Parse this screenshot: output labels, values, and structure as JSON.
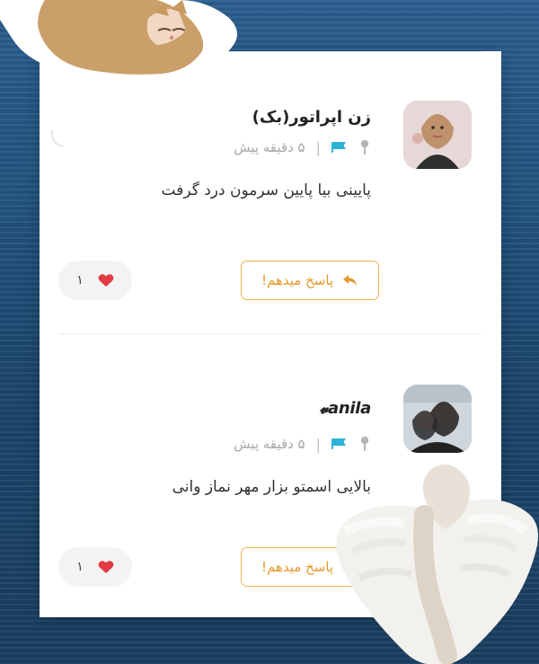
{
  "comments": [
    {
      "username": "زن اپراتور(بک)",
      "time": "۵ دقیقه پیش",
      "text": "پایینی بیا پایین سرمون درد گرفت",
      "reply_label": "پاسخ میدهم!",
      "likes": "۱"
    },
    {
      "username": "𝓿anila",
      "time": "۵ دقیقه پیش",
      "text": "بالایی اسمتو بزار مهر نماز وانی",
      "reply_label": "پاسخ میدهم!",
      "likes": "۱"
    }
  ],
  "colors": {
    "accent": "#f0b24b",
    "flag": "#2cb2d6",
    "heart": "#e33a44"
  },
  "icons": {
    "pin": "pin-icon",
    "flag": "flag-icon",
    "reply": "reply-arrow-icon",
    "heart": "heart-icon"
  }
}
